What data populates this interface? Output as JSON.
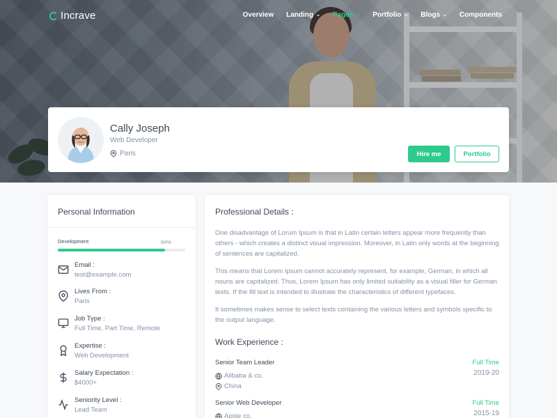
{
  "brand": {
    "name": "Incrave",
    "accent": "#2eca8b"
  },
  "nav": {
    "items": [
      {
        "label": "Overview",
        "dropdown": false,
        "active": false
      },
      {
        "label": "Landing",
        "dropdown": true,
        "active": false
      },
      {
        "label": "Pages",
        "dropdown": true,
        "active": true
      },
      {
        "label": "Portfolio",
        "dropdown": true,
        "active": false
      },
      {
        "label": "Blogs",
        "dropdown": true,
        "active": false
      },
      {
        "label": "Components",
        "dropdown": false,
        "active": false
      }
    ]
  },
  "profile": {
    "name": "Cally Joseph",
    "role": "Web Developer",
    "location": "Paris",
    "hire_label": "Hire me",
    "portfolio_label": "Portfolio"
  },
  "personal": {
    "title": "Personal Information",
    "skill": {
      "label": "Development",
      "value_text": "84%",
      "percent": 84
    },
    "items": [
      {
        "icon": "mail-icon",
        "label": "Email :",
        "value": "test@example.com"
      },
      {
        "icon": "map-pin-icon",
        "label": "Lives From :",
        "value": "Paris"
      },
      {
        "icon": "monitor-icon",
        "label": "Job Type :",
        "value": "Full Time, Part Time, Remote"
      },
      {
        "icon": "award-icon",
        "label": "Expertise :",
        "value": "Web Development"
      },
      {
        "icon": "dollar-icon",
        "label": "Salary Expectation :",
        "value": "$4000+"
      },
      {
        "icon": "activity-icon",
        "label": "Seniority Level :",
        "value": "Lead Team"
      }
    ]
  },
  "professional": {
    "title": "Professional Details :",
    "paragraphs": [
      "One disadvantage of Lorum Ipsum is that in Latin certain letters appear more frequently than others - which creates a distinct visual impression. Moreover, in Latin only words at the beginning of sentences are capitalized.",
      "This means that Lorem Ipsum cannot accurately represent, for example, German, in which all nouns are capitalized. Thus, Lorem Ipsum has only limited suitability as a visual filler for German texts. If the fill text is intended to illustrate the characteristics of different typefaces.",
      "It sometimes makes sense to select texts containing the various letters and symbols specific to the output language."
    ],
    "experience_title": "Work Experience :",
    "jobs": [
      {
        "title": "Senior Team Leader",
        "company": "Alibaba & co.",
        "country": "China",
        "type": "Full Time",
        "years": "2019-20"
      },
      {
        "title": "Senior Web Developer",
        "company": "Apple co.",
        "country": "",
        "type": "Full Time",
        "years": "2015-19"
      }
    ]
  }
}
